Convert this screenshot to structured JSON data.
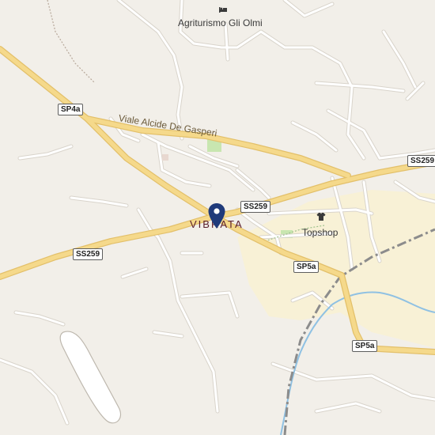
{
  "map": {
    "colors": {
      "background": "#f2efe9",
      "major_road": "#f5d98b",
      "major_road_casing": "#e3c06a",
      "minor_road": "#ffffff",
      "minor_road_casing": "#d9d4cb",
      "urban_area": "#f8f1d6",
      "park": "#c8e6b0",
      "railway": "#8c8c8c",
      "water": "#8fc1e3",
      "marker": "#1f3a7a"
    },
    "labels": {
      "town": "VIBRATA",
      "poi_hotel": "Agriturismo Gli Olmi",
      "poi_shop": "Topshop",
      "street_main": "Viale Alcide De Gasperi"
    },
    "shields": {
      "sp4a": "SP4a",
      "ss259_center": "SS259",
      "ss259_west": "SS259",
      "ss259_east": "SS259",
      "sp5a_center": "SP5a",
      "sp5a_south": "SP5a"
    },
    "icons": {
      "hotel": "bed-icon",
      "shop": "shirt-icon",
      "marker": "location-pin-icon"
    }
  }
}
